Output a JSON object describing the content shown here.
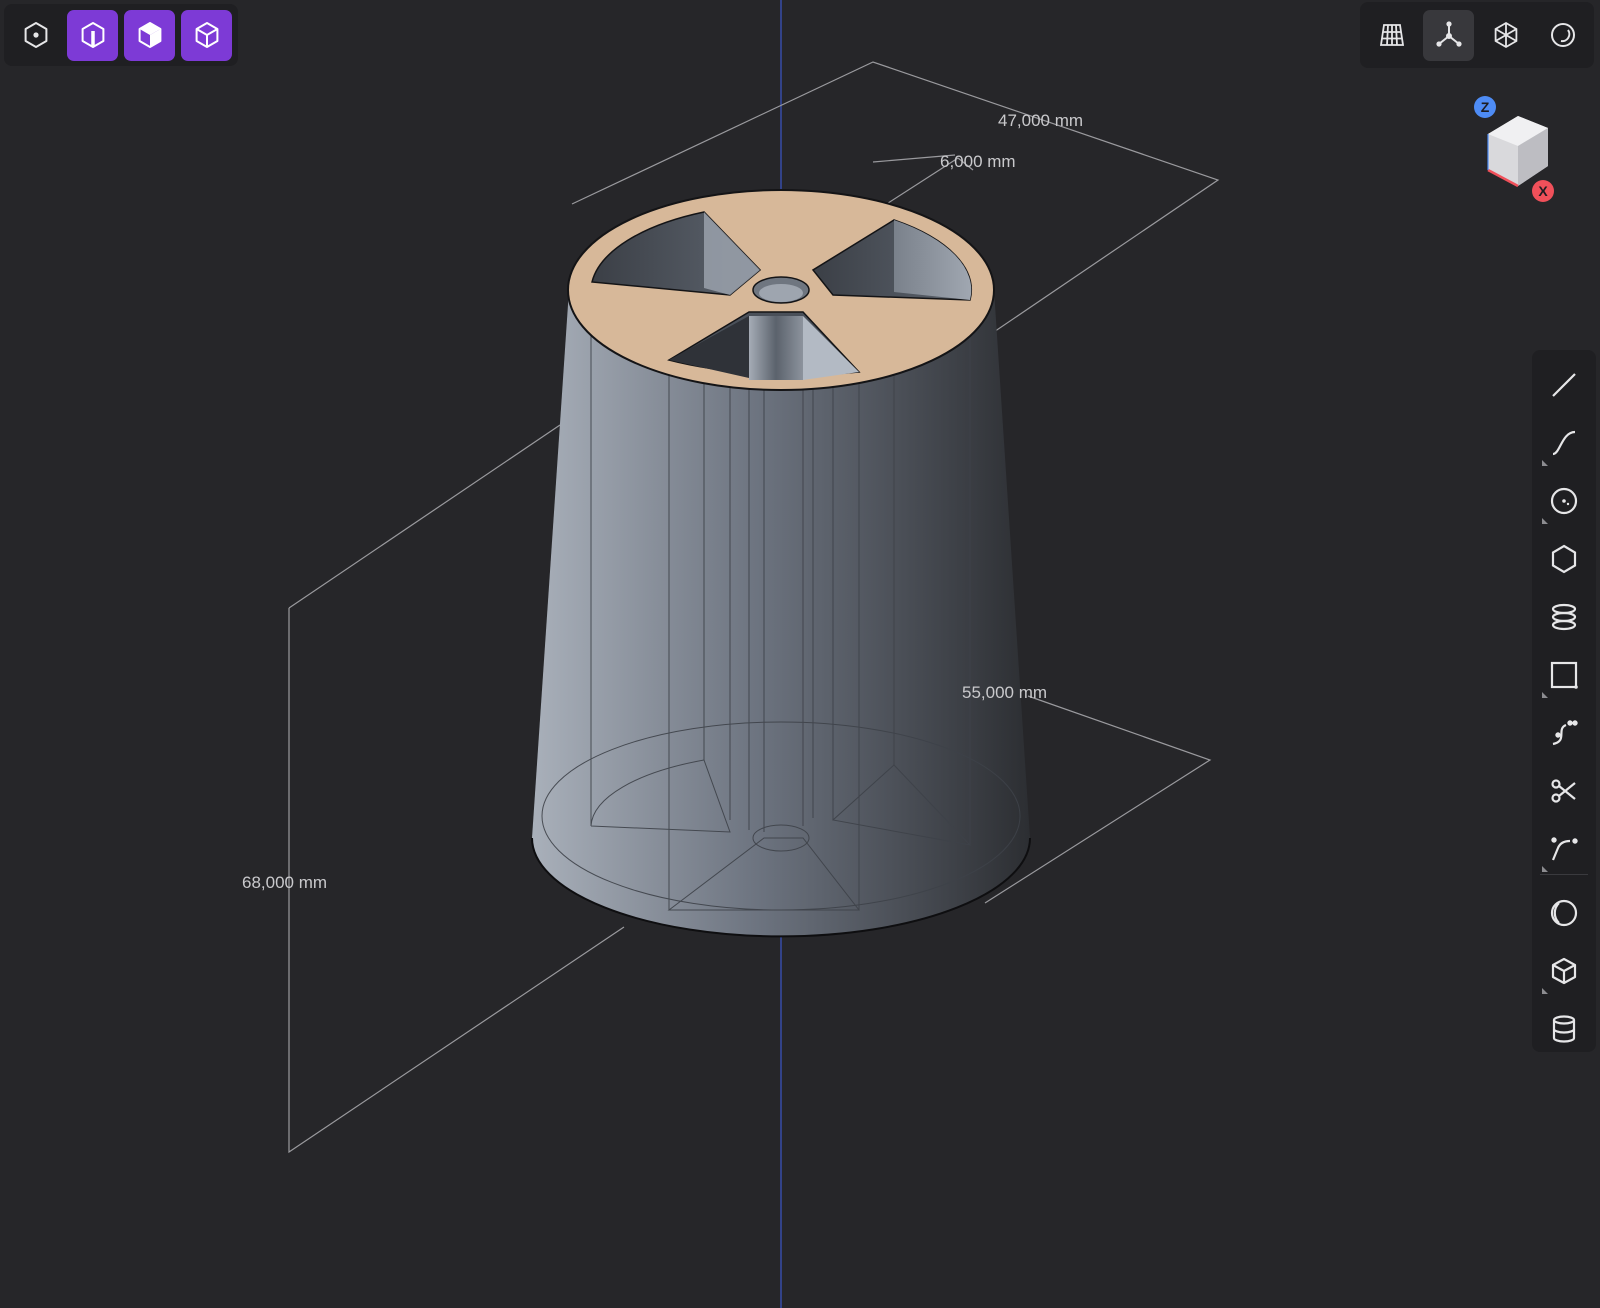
{
  "dimensions": {
    "top_diameter": "47,000 mm",
    "spoke_width": "6,000 mm",
    "bottom_diameter": "55,000 mm",
    "height": "68,000 mm"
  },
  "view_cube": {
    "z_label": "Z",
    "x_label": "X",
    "z_color": "#4e8cf5",
    "x_color": "#f0505a"
  },
  "colors": {
    "background": "#262629",
    "toolbar": "#1f1f22",
    "accent": "#7d3ad6",
    "top_face": "#d7b899",
    "z_axis_line": "#3a55c8"
  },
  "select_toolbar": {
    "items": [
      {
        "icon": "vertex-select-icon",
        "active": false
      },
      {
        "icon": "edge-select-icon",
        "active": true
      },
      {
        "icon": "face-select-icon",
        "active": true
      },
      {
        "icon": "solid-select-icon",
        "active": true
      }
    ]
  },
  "view_toolbar": {
    "items": [
      {
        "icon": "grid-icon",
        "pressed": false
      },
      {
        "icon": "axes-icon",
        "pressed": true
      },
      {
        "icon": "wireframe-sphere-icon",
        "pressed": false
      },
      {
        "icon": "render-mode-icon",
        "pressed": false
      }
    ]
  },
  "draw_toolbar": {
    "tools": [
      {
        "icon": "line-icon"
      },
      {
        "icon": "curve-icon"
      },
      {
        "icon": "circle-icon"
      },
      {
        "icon": "polygon-icon"
      },
      {
        "icon": "spiral-icon"
      },
      {
        "icon": "rectangle-icon"
      },
      {
        "icon": "spline-icon"
      },
      {
        "icon": "scissors-icon"
      },
      {
        "icon": "fillet-icon"
      },
      {
        "icon": "sphere-icon"
      },
      {
        "icon": "box-icon"
      },
      {
        "icon": "cylinder-icon"
      }
    ]
  }
}
